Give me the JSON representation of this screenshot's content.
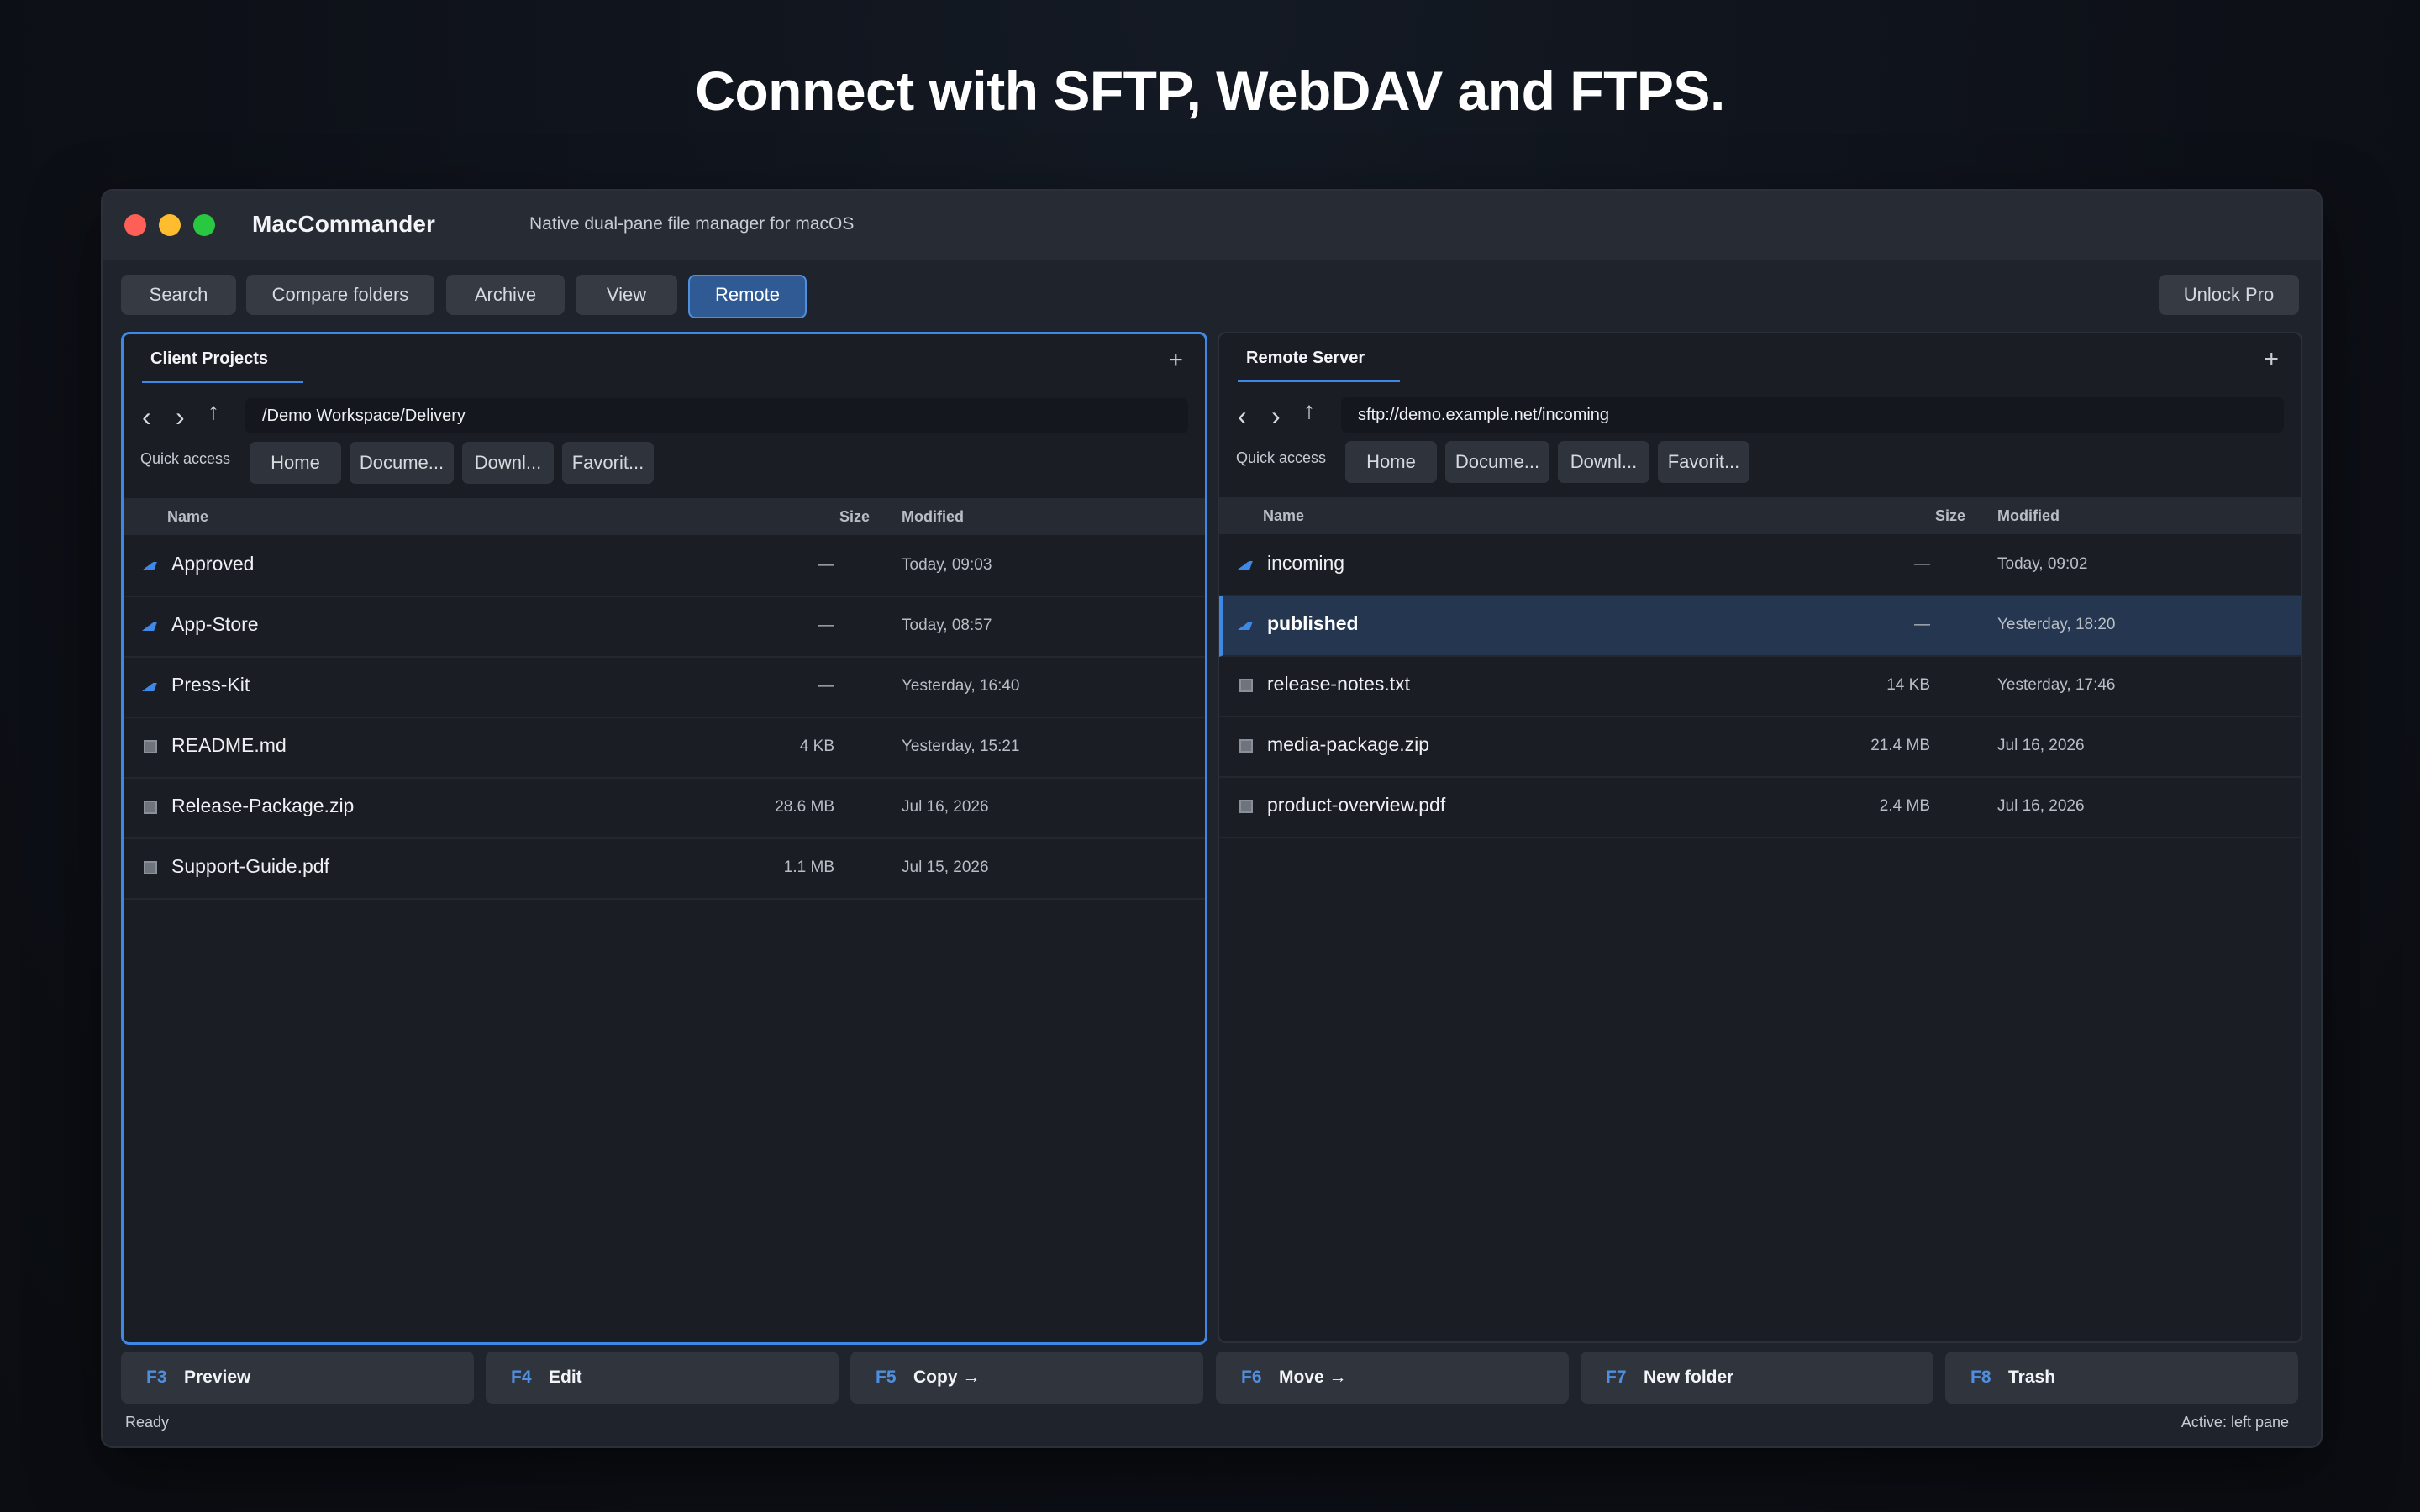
{
  "headline": "Connect with SFTP, WebDAV and FTPS.",
  "app": {
    "name": "MacCommander",
    "subtitle": "Native dual-pane file manager for macOS"
  },
  "toolbar": {
    "buttons": [
      "Search",
      "Compare folders",
      "Archive",
      "View",
      "Remote"
    ],
    "active": "Remote",
    "unlock": "Unlock Pro"
  },
  "columns": {
    "name": "Name",
    "size": "Size",
    "modified": "Modified"
  },
  "quick_access_label": "Quick access",
  "quick_access": [
    "Home",
    "Docume...",
    "Downl...",
    "Favorit..."
  ],
  "left_pane": {
    "tab": "Client Projects",
    "path": "/Demo Workspace/Delivery",
    "rows": [
      {
        "icon": "folder-icon",
        "name": "Approved",
        "size": "—",
        "modified": "Today, 09:03"
      },
      {
        "icon": "folder-icon",
        "name": "App-Store",
        "size": "—",
        "modified": "Today, 08:57"
      },
      {
        "icon": "folder-icon",
        "name": "Press-Kit",
        "size": "—",
        "modified": "Yesterday, 16:40"
      },
      {
        "icon": "file-icon",
        "name": "README.md",
        "size": "4 KB",
        "modified": "Yesterday, 15:21"
      },
      {
        "icon": "file-icon",
        "name": "Release-Package.zip",
        "size": "28.6 MB",
        "modified": "Jul 16, 2026"
      },
      {
        "icon": "file-icon",
        "name": "Support-Guide.pdf",
        "size": "1.1 MB",
        "modified": "Jul 15, 2026"
      }
    ]
  },
  "right_pane": {
    "tab": "Remote Server",
    "path": "sftp://demo.example.net/incoming",
    "rows": [
      {
        "icon": "folder-icon",
        "name": "incoming",
        "size": "—",
        "modified": "Today, 09:02"
      },
      {
        "icon": "folder-icon",
        "name": "published",
        "size": "—",
        "modified": "Yesterday, 18:20",
        "selected": true
      },
      {
        "icon": "file-icon",
        "name": "release-notes.txt",
        "size": "14 KB",
        "modified": "Yesterday, 17:46"
      },
      {
        "icon": "file-icon",
        "name": "media-package.zip",
        "size": "21.4 MB",
        "modified": "Jul 16, 2026"
      },
      {
        "icon": "file-icon",
        "name": "product-overview.pdf",
        "size": "2.4 MB",
        "modified": "Jul 16, 2026"
      }
    ]
  },
  "fkeys": [
    {
      "key": "F3",
      "label": "Preview"
    },
    {
      "key": "F4",
      "label": "Edit"
    },
    {
      "key": "F5",
      "label": "Copy →"
    },
    {
      "key": "F6",
      "label": "Move →"
    },
    {
      "key": "F7",
      "label": "New folder"
    },
    {
      "key": "F8",
      "label": "Trash"
    }
  ],
  "status": {
    "left": "Ready",
    "right": "Active: left pane"
  },
  "colors": {
    "accent": "#3f88e6",
    "background": "#0d1017",
    "window": "#1f232b"
  }
}
